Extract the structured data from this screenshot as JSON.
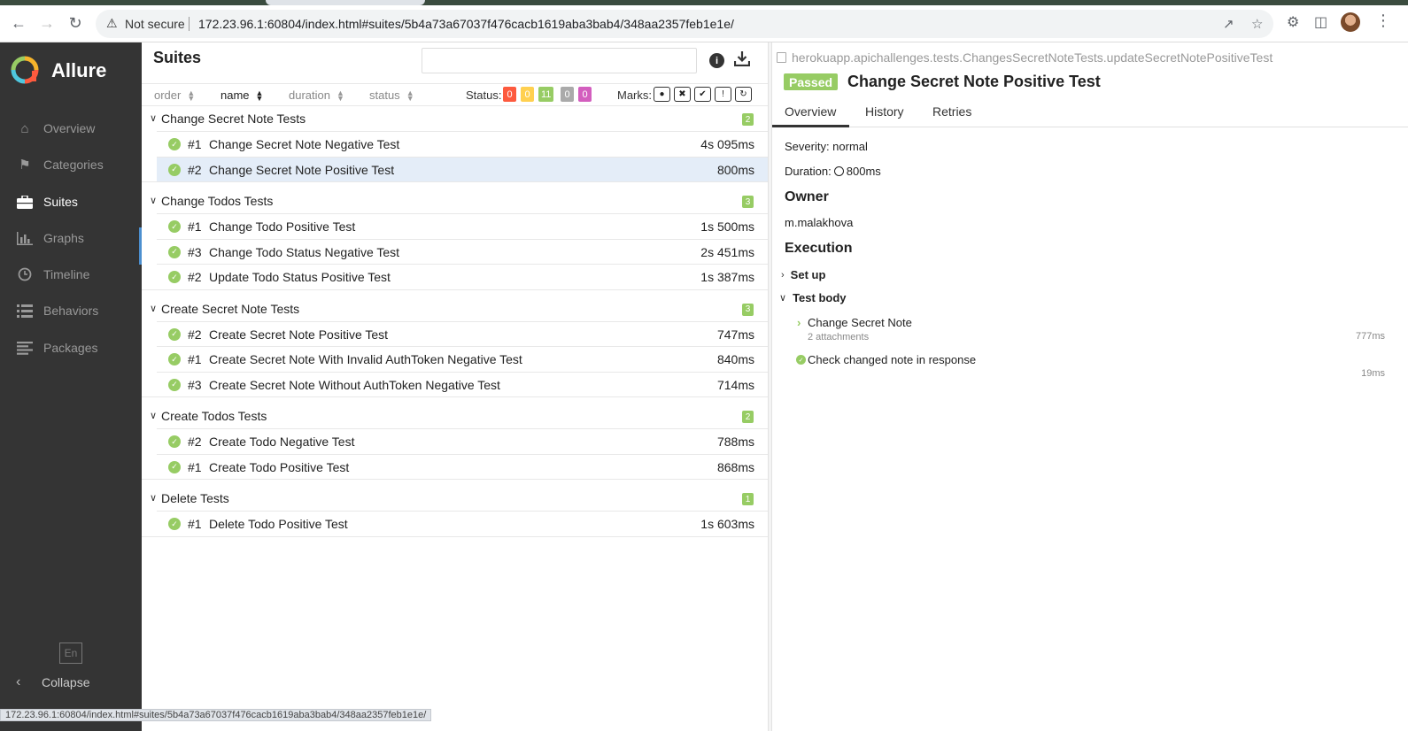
{
  "browser": {
    "not_secure": "Not secure",
    "url": "172.23.96.1:60804/index.html#suites/5b4a73a67037f476cacb1619aba3bab4/348aa2357feb1e1e/",
    "status_bar_url": "172.23.96.1:60804/index.html#suites/5b4a73a67037f476cacb1619aba3bab4/348aa2357feb1e1e/"
  },
  "sidebar": {
    "brand": "Allure",
    "items": [
      {
        "label": "Overview",
        "icon": "home-icon"
      },
      {
        "label": "Categories",
        "icon": "flag-icon"
      },
      {
        "label": "Suites",
        "icon": "briefcase-icon"
      },
      {
        "label": "Graphs",
        "icon": "bar-chart-icon"
      },
      {
        "label": "Timeline",
        "icon": "clock-icon"
      },
      {
        "label": "Behaviors",
        "icon": "list-icon"
      },
      {
        "label": "Packages",
        "icon": "align-left-icon"
      }
    ],
    "active": "Suites",
    "language": "En",
    "collapse_label": "Collapse"
  },
  "suites": {
    "title": "Suites",
    "sort": {
      "order": "order",
      "name": "name",
      "duration": "duration",
      "status": "status"
    },
    "status_label": "Status:",
    "status_counts": [
      {
        "value": "0",
        "color": "#fd5a3e"
      },
      {
        "value": "0",
        "color": "#ffd050"
      },
      {
        "value": "11",
        "color": "#97cc64"
      },
      {
        "value": "0",
        "color": "#aaaaaa"
      },
      {
        "value": "0",
        "color": "#d35ebe"
      }
    ],
    "marks_label": "Marks:",
    "groups": [
      {
        "name": "Change Secret Note Tests",
        "count": "2",
        "tests": [
          {
            "num": "#1",
            "name": "Change Secret Note Negative Test",
            "duration": "4s 095ms"
          },
          {
            "num": "#2",
            "name": "Change Secret Note Positive Test",
            "duration": "800ms",
            "selected": true
          }
        ]
      },
      {
        "name": "Change Todos Tests",
        "count": "3",
        "tests": [
          {
            "num": "#1",
            "name": "Change Todo Positive Test",
            "duration": "1s 500ms"
          },
          {
            "num": "#3",
            "name": "Change Todo Status Negative Test",
            "duration": "2s 451ms"
          },
          {
            "num": "#2",
            "name": "Update Todo Status Positive Test",
            "duration": "1s 387ms"
          }
        ]
      },
      {
        "name": "Create Secret Note Tests",
        "count": "3",
        "tests": [
          {
            "num": "#2",
            "name": "Create Secret Note Positive Test",
            "duration": "747ms"
          },
          {
            "num": "#1",
            "name": "Create Secret Note With Invalid AuthToken Negative Test",
            "duration": "840ms"
          },
          {
            "num": "#3",
            "name": "Create Secret Note Without AuthToken Negative Test",
            "duration": "714ms"
          }
        ]
      },
      {
        "name": "Create Todos Tests",
        "count": "2",
        "tests": [
          {
            "num": "#2",
            "name": "Create Todo Negative Test",
            "duration": "788ms"
          },
          {
            "num": "#1",
            "name": "Create Todo Positive Test",
            "duration": "868ms"
          }
        ]
      },
      {
        "name": "Delete Tests",
        "count": "1",
        "tests": [
          {
            "num": "#1",
            "name": "Delete Todo Positive Test",
            "duration": "1s 603ms"
          }
        ]
      }
    ]
  },
  "detail": {
    "full_name": "herokuapp.apichallenges.tests.ChangesSecretNoteTests.updateSecretNotePositiveTest",
    "status": "Passed",
    "title": "Change Secret Note Positive Test",
    "tabs": [
      "Overview",
      "History",
      "Retries"
    ],
    "active_tab": "Overview",
    "severity": "Severity: normal",
    "duration_label": "Duration:",
    "duration_value": "800ms",
    "owner_heading": "Owner",
    "owner": "m.malakhova",
    "execution_heading": "Execution",
    "setup": "Set up",
    "test_body": "Test body",
    "steps": [
      {
        "name": "Change Secret Note",
        "sub": "2 attachments",
        "duration": "777ms"
      },
      {
        "name": "Check changed note in response",
        "duration": "19ms"
      }
    ]
  }
}
